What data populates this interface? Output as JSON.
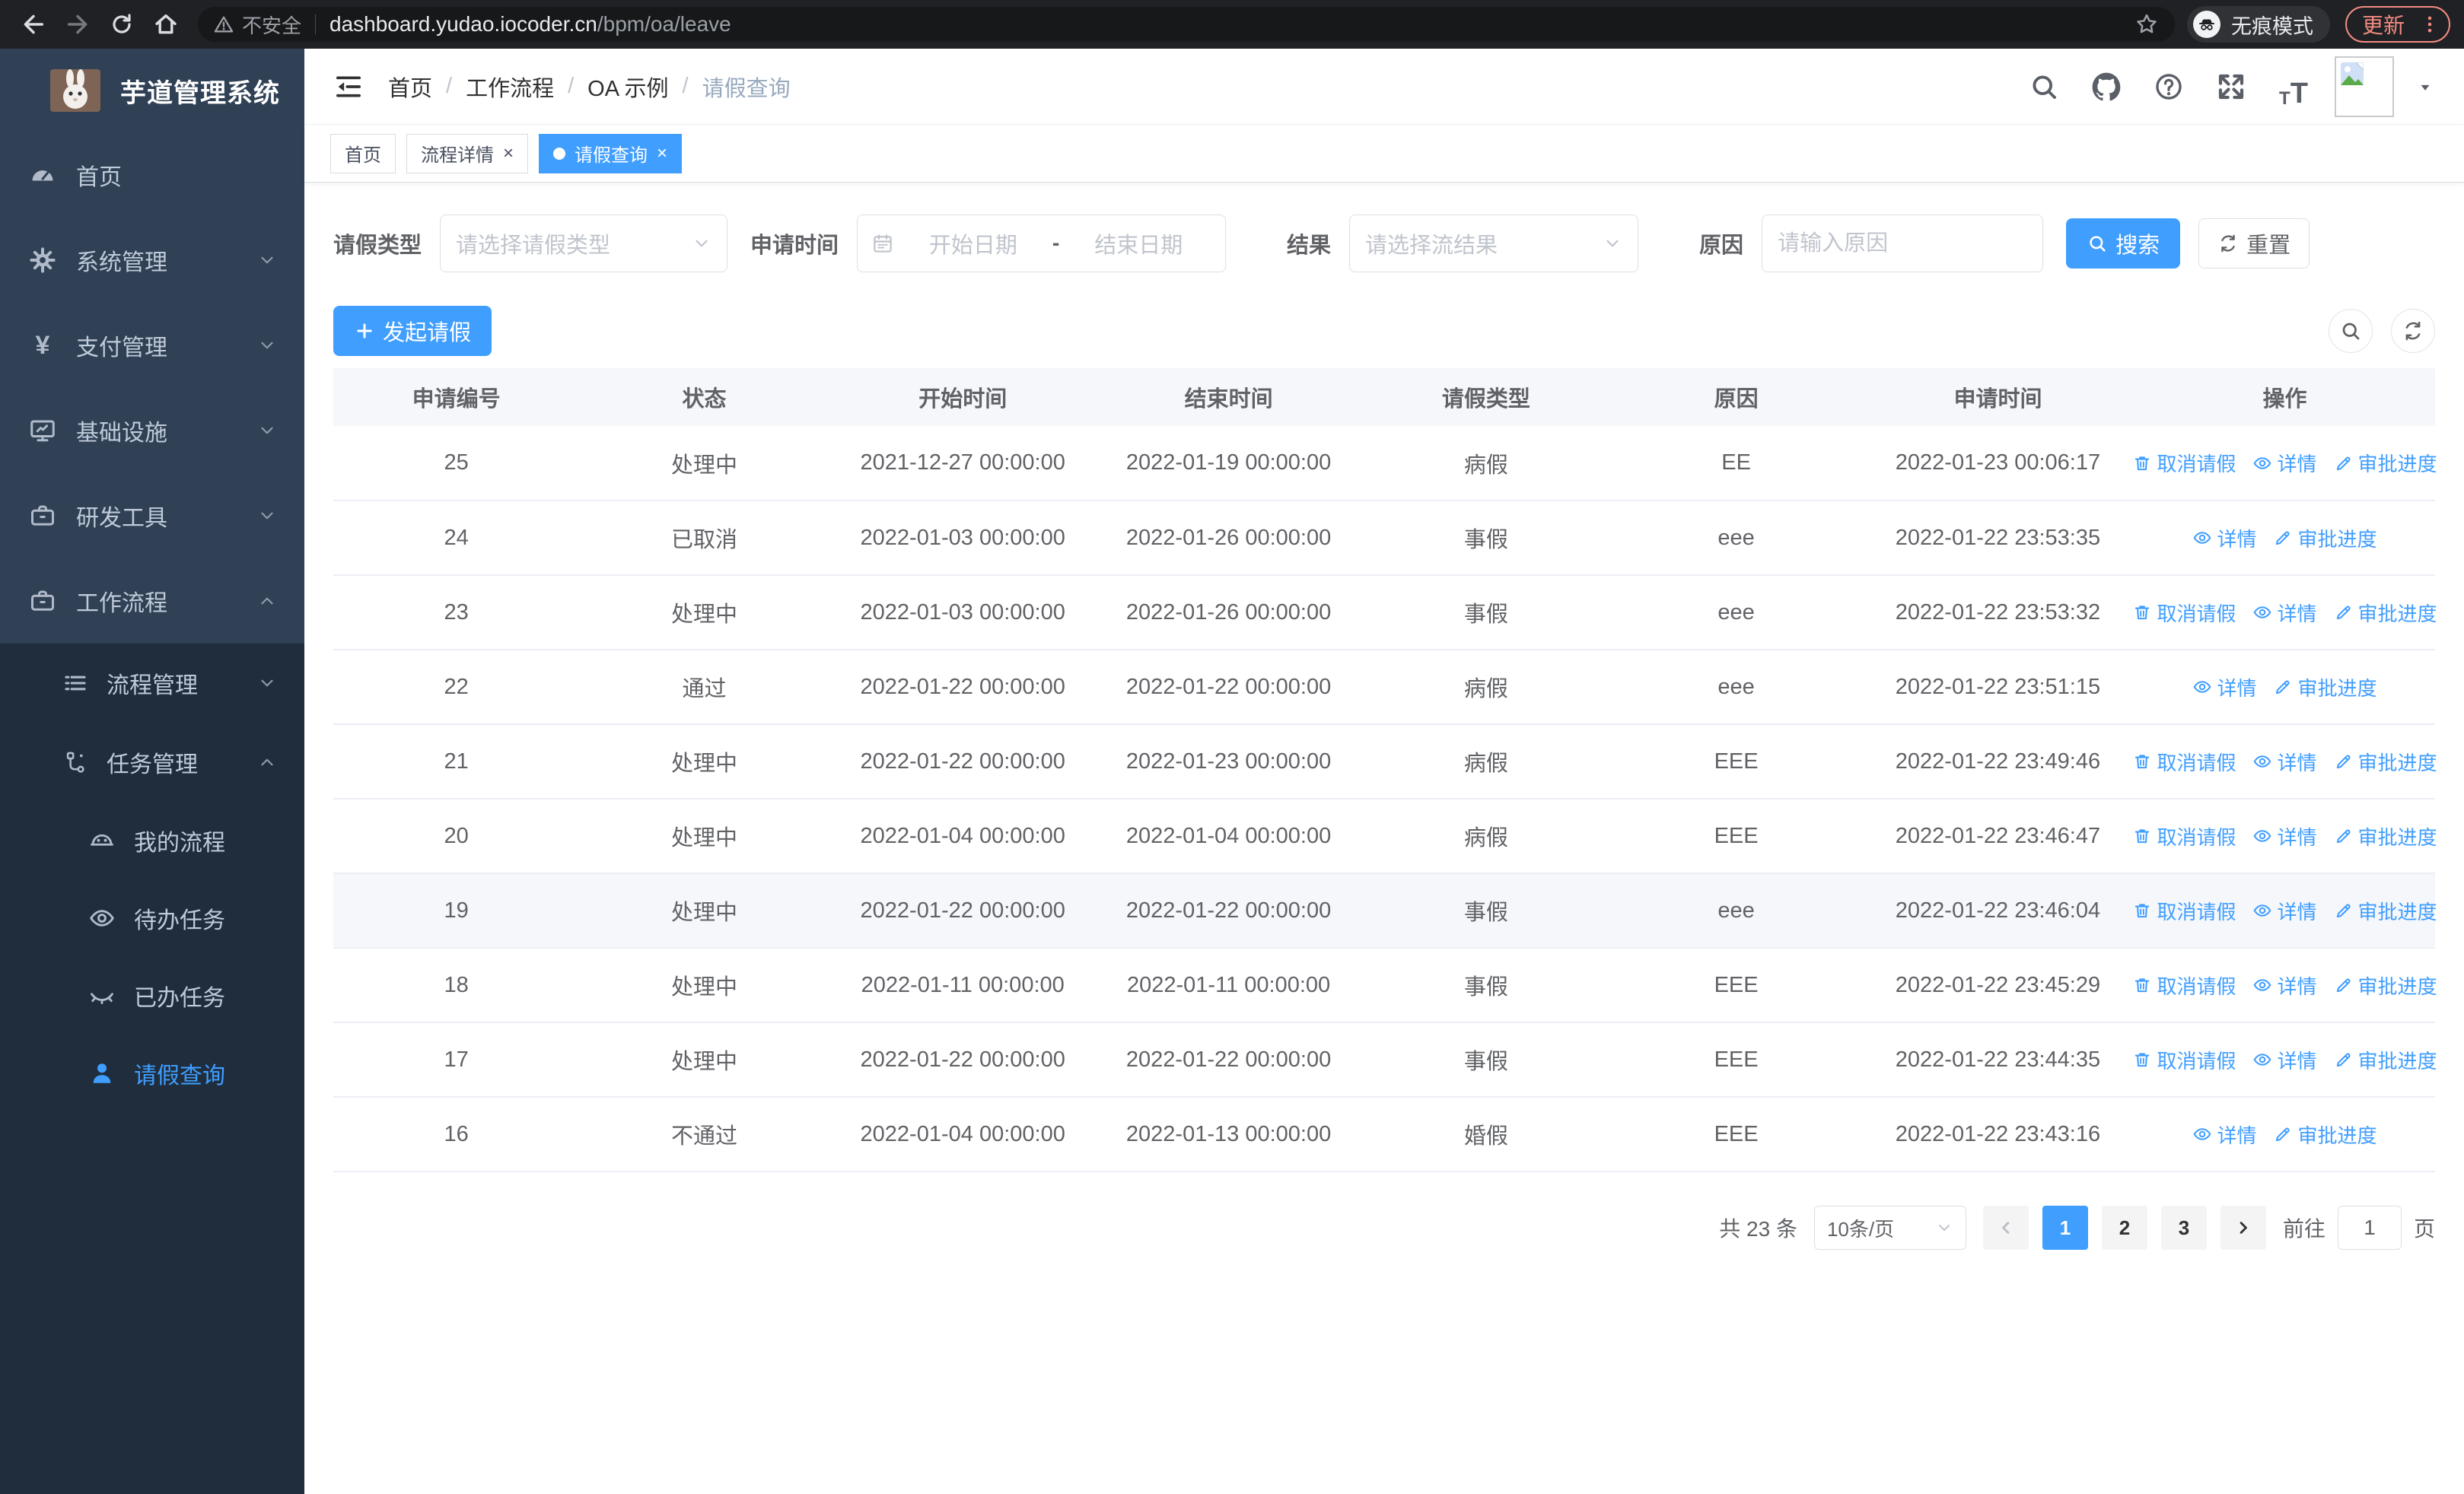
{
  "browser": {
    "security_label": "不安全",
    "url_host": "dashboard.yudao.iocoder.cn",
    "url_path": "/bpm/oa/leave",
    "incognito_label": "无痕模式",
    "update_label": "更新"
  },
  "sidebar": {
    "title": "芋道管理系统",
    "menu": [
      {
        "label": "首页",
        "icon": "dashboard-icon"
      },
      {
        "label": "系统管理",
        "icon": "gear-icon",
        "arrow": "down"
      },
      {
        "label": "支付管理",
        "icon": "yen-icon",
        "arrow": "down"
      },
      {
        "label": "基础设施",
        "icon": "monitor-icon",
        "arrow": "down"
      },
      {
        "label": "研发工具",
        "icon": "toolbox-icon",
        "arrow": "down"
      },
      {
        "label": "工作流程",
        "icon": "briefcase-icon",
        "arrow": "up"
      }
    ],
    "submenu": [
      {
        "label": "流程管理",
        "icon": "list-icon",
        "arrow": "down"
      },
      {
        "label": "任务管理",
        "icon": "flow-icon",
        "arrow": "up"
      },
      {
        "label": "我的流程",
        "icon": "robot-face-icon"
      },
      {
        "label": "待办任务",
        "icon": "eye-open-icon"
      },
      {
        "label": "已办任务",
        "icon": "eye-closed-icon"
      },
      {
        "label": "请假查询",
        "icon": "user-icon",
        "active": true
      }
    ]
  },
  "navbar": {
    "breadcrumb": [
      "首页",
      "工作流程",
      "OA 示例",
      "请假查询"
    ]
  },
  "tabs": [
    {
      "label": "首页"
    },
    {
      "label": "流程详情",
      "closable": true
    },
    {
      "label": "请假查询",
      "closable": true,
      "active": true
    }
  ],
  "filters": {
    "leave_type": {
      "label": "请假类型",
      "placeholder": "请选择请假类型"
    },
    "apply_time": {
      "label": "申请时间",
      "start_placeholder": "开始日期",
      "separator": "-",
      "end_placeholder": "结束日期"
    },
    "result": {
      "label": "结果",
      "placeholder": "请选择流结果"
    },
    "reason": {
      "label": "原因",
      "placeholder": "请输入原因"
    },
    "search_label": "搜索",
    "reset_label": "重置"
  },
  "toolbar": {
    "create_label": "发起请假"
  },
  "table": {
    "columns": [
      "申请编号",
      "状态",
      "开始时间",
      "结束时间",
      "请假类型",
      "原因",
      "申请时间",
      "操作"
    ],
    "action_labels": {
      "cancel": "取消请假",
      "detail": "详情",
      "progress": "审批进度"
    },
    "rows": [
      {
        "id": "25",
        "status": "处理中",
        "start": "2021-12-27 00:00:00",
        "end": "2022-01-19 00:00:00",
        "type": "病假",
        "reason": "EE",
        "applied": "2022-01-23 00:06:17",
        "cancellable": true
      },
      {
        "id": "24",
        "status": "已取消",
        "start": "2022-01-03 00:00:00",
        "end": "2022-01-26 00:00:00",
        "type": "事假",
        "reason": "eee",
        "applied": "2022-01-22 23:53:35",
        "cancellable": false
      },
      {
        "id": "23",
        "status": "处理中",
        "start": "2022-01-03 00:00:00",
        "end": "2022-01-26 00:00:00",
        "type": "事假",
        "reason": "eee",
        "applied": "2022-01-22 23:53:32",
        "cancellable": true
      },
      {
        "id": "22",
        "status": "通过",
        "start": "2022-01-22 00:00:00",
        "end": "2022-01-22 00:00:00",
        "type": "病假",
        "reason": "eee",
        "applied": "2022-01-22 23:51:15",
        "cancellable": false
      },
      {
        "id": "21",
        "status": "处理中",
        "start": "2022-01-22 00:00:00",
        "end": "2022-01-23 00:00:00",
        "type": "病假",
        "reason": "EEE",
        "applied": "2022-01-22 23:49:46",
        "cancellable": true
      },
      {
        "id": "20",
        "status": "处理中",
        "start": "2022-01-04 00:00:00",
        "end": "2022-01-04 00:00:00",
        "type": "病假",
        "reason": "EEE",
        "applied": "2022-01-22 23:46:47",
        "cancellable": true
      },
      {
        "id": "19",
        "status": "处理中",
        "start": "2022-01-22 00:00:00",
        "end": "2022-01-22 00:00:00",
        "type": "事假",
        "reason": "eee",
        "applied": "2022-01-22 23:46:04",
        "cancellable": true,
        "highlight": true
      },
      {
        "id": "18",
        "status": "处理中",
        "start": "2022-01-11 00:00:00",
        "end": "2022-01-11 00:00:00",
        "type": "事假",
        "reason": "EEE",
        "applied": "2022-01-22 23:45:29",
        "cancellable": true
      },
      {
        "id": "17",
        "status": "处理中",
        "start": "2022-01-22 00:00:00",
        "end": "2022-01-22 00:00:00",
        "type": "事假",
        "reason": "EEE",
        "applied": "2022-01-22 23:44:35",
        "cancellable": true
      },
      {
        "id": "16",
        "status": "不通过",
        "start": "2022-01-04 00:00:00",
        "end": "2022-01-13 00:00:00",
        "type": "婚假",
        "reason": "EEE",
        "applied": "2022-01-22 23:43:16",
        "cancellable": false
      }
    ]
  },
  "pagination": {
    "total": "共 23 条",
    "page_size": "10条/页",
    "pages": [
      "1",
      "2",
      "3"
    ],
    "active_page": "1",
    "goto_label": "前往",
    "goto_value": "1",
    "page_label": "页"
  },
  "icons": {
    "browser": [
      "back-icon",
      "forward-icon",
      "reload-icon",
      "home-icon",
      "warning-icon",
      "star-icon",
      "incognito-icon",
      "menu-dots-icon"
    ],
    "navbar": [
      "hamburger-icon",
      "search-icon",
      "github-icon",
      "question-icon",
      "fullscreen-icon",
      "font-size-icon",
      "avatar-placeholder",
      "caret-down-icon"
    ],
    "actions": [
      "trash-icon",
      "eye-icon",
      "pen-icon"
    ]
  },
  "colors": {
    "primary": "#409EFF",
    "sidebar_bg": "#304156",
    "submenu_bg": "#1F2D3D",
    "sidebar_text": "#BFCBD9",
    "browser_bar": "#202124",
    "update_accent": "#F28B82",
    "table_header_bg": "#F5F7FA",
    "border": "#DCDFE6",
    "row_border": "#EBEEF5",
    "text": "#606266"
  }
}
